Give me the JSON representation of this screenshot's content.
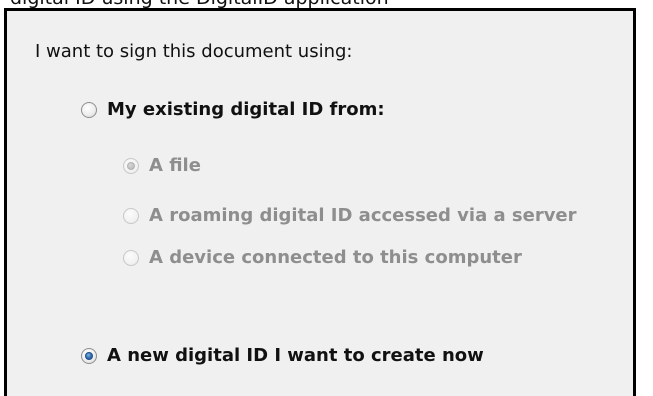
{
  "top_cut_text": "digital ID using the DigitalID application",
  "heading": "I want to sign this document using:",
  "options": {
    "existing": {
      "label": "My existing digital ID from:",
      "checked": false,
      "disabled": false,
      "icon": "radio-icon"
    },
    "new_id": {
      "label": "A new digital ID I want to create now",
      "checked": true,
      "disabled": false,
      "icon": "radio-icon"
    }
  },
  "existing_suboptions": [
    {
      "label": "A file",
      "checked": true,
      "disabled": true
    },
    {
      "label": "A roaming digital ID accessed via a server",
      "checked": false,
      "disabled": true
    },
    {
      "label": "A device connected to this computer",
      "checked": false,
      "disabled": true
    }
  ],
  "colors": {
    "panel_bg": "#f0f0f0",
    "border": "#000000",
    "text": "#111111",
    "disabled_text": "#8e8e8e",
    "radio_selected": "#2f6cb0"
  }
}
